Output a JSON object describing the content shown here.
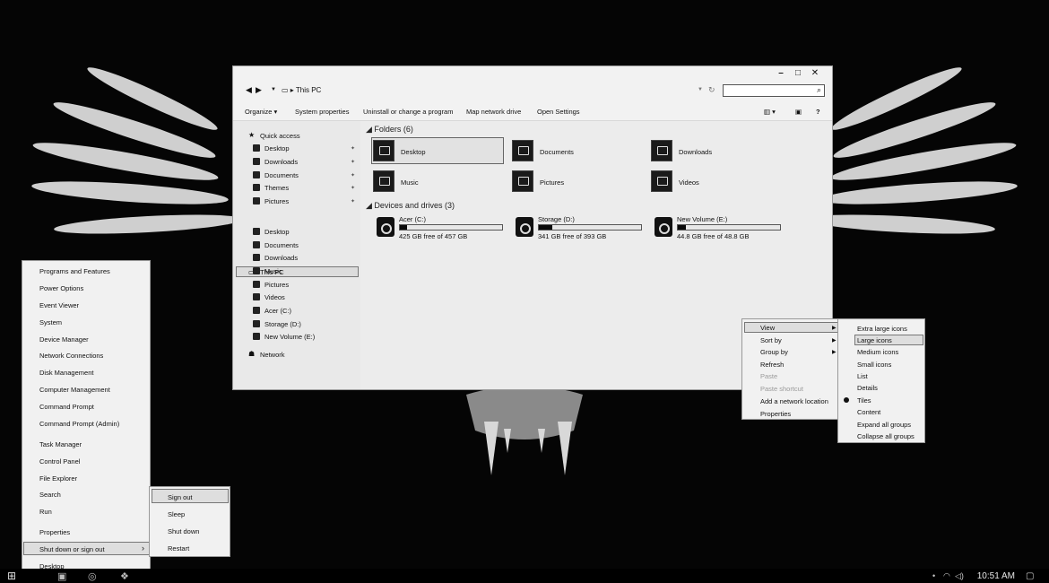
{
  "explorer": {
    "caption": {
      "minimize": "–",
      "maximize": "□",
      "close": "✕"
    },
    "breadcrumb": "This PC",
    "search": {
      "placeholder": ""
    },
    "toolbar": [
      "Organize ▾",
      "System properties",
      "Uninstall or change a program",
      "Map network drive",
      "Open Settings"
    ],
    "help": "?",
    "nav": {
      "quick_access": "Quick access",
      "quick_items": [
        "Desktop",
        "Downloads",
        "Documents",
        "Themes",
        "Pictures"
      ],
      "this_pc": "This PC",
      "pc_items": [
        "Desktop",
        "Documents",
        "Downloads",
        "Music",
        "Pictures",
        "Videos",
        "Acer (C:)",
        "Storage (D:)",
        "New Volume (E:)"
      ],
      "network": "Network"
    },
    "folders_header": "Folders (6)",
    "folders": [
      "Desktop",
      "Documents",
      "Downloads",
      "Music",
      "Pictures",
      "Videos"
    ],
    "drives_header": "Devices and drives (3)",
    "drives": [
      {
        "name": "Acer (C:)",
        "free": "425 GB free of 457 GB",
        "used_fraction": 0.07
      },
      {
        "name": "Storage (D:)",
        "free": "341 GB free of 393 GB",
        "used_fraction": 0.13
      },
      {
        "name": "New Volume (E:)",
        "free": "44.8 GB free of 48.8 GB",
        "used_fraction": 0.08
      }
    ]
  },
  "winx_menu": {
    "items": [
      "Programs and Features",
      "Power Options",
      "Event Viewer",
      "System",
      "Device Manager",
      "Network Connections",
      "Disk Management",
      "Computer Management",
      "Command Prompt",
      "Command Prompt (Admin)",
      "Task Manager",
      "Control Panel",
      "File Explorer",
      "Search",
      "Run",
      "Properties",
      "Shut down or sign out",
      "Desktop"
    ],
    "submenu": [
      "Sign out",
      "Sleep",
      "Shut down",
      "Restart"
    ]
  },
  "context_menu": {
    "items": [
      "View",
      "Sort by",
      "Group by",
      "Refresh",
      "Paste",
      "Paste shortcut",
      "Add a network location",
      "Properties"
    ],
    "view_submenu": [
      "Extra large icons",
      "Large icons",
      "Medium icons",
      "Small icons",
      "List",
      "Details",
      "Tiles",
      "Content",
      "Expand all groups",
      "Collapse all groups"
    ]
  },
  "taskbar": {
    "clock": "10:51 AM",
    "tray_icons": [
      "network-icon",
      "volume-icon",
      "notification-icon"
    ]
  },
  "colors": {
    "window_bg": "#e6e6e6",
    "menu_bg": "#f1f1f1",
    "desktop_bg": "#050505"
  }
}
